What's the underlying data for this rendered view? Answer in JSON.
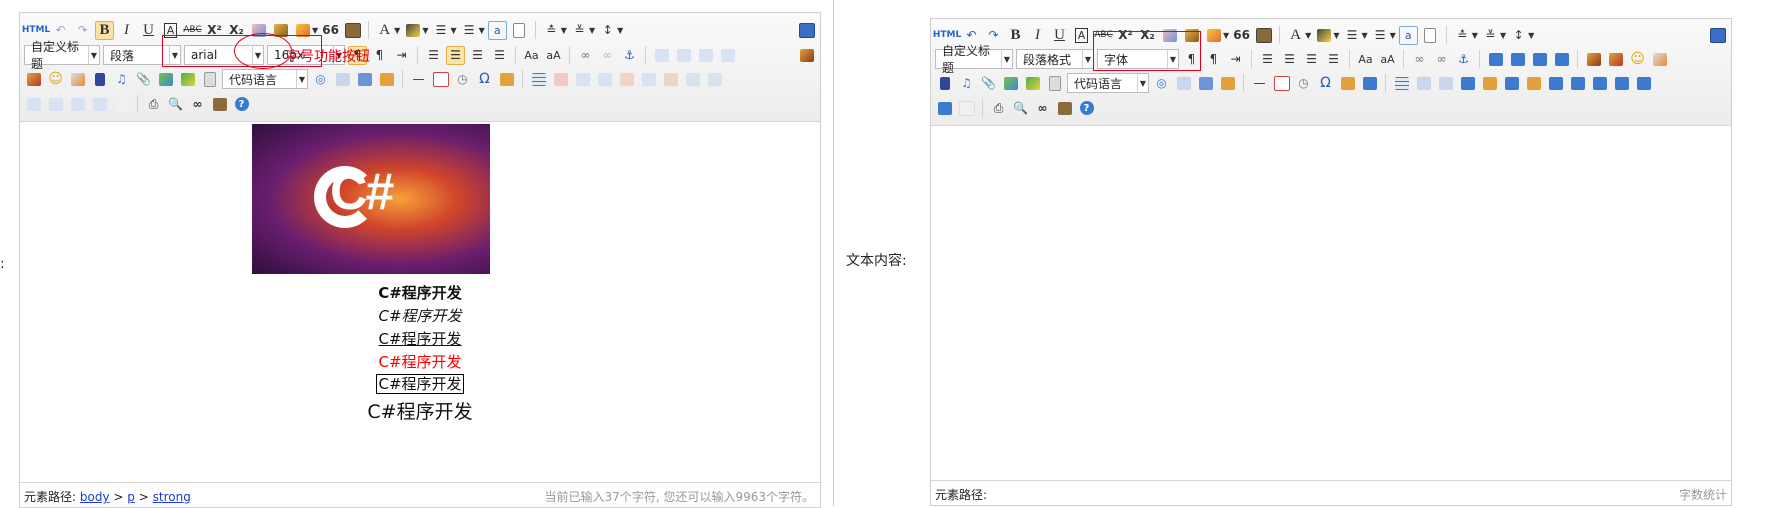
{
  "left_side_label": ":",
  "editor_left": {
    "toolbar_row1": {
      "source_label": "HTML",
      "bold_label": "B",
      "italic_label": "I",
      "underline_label": "U",
      "fontborder_label": "A",
      "strike_label": "ABC",
      "superscript_label": "X²",
      "subscript_label": "X₂",
      "blockquote_label": "66",
      "forecolor_label": "A",
      "insertframe_label": "a"
    },
    "toolbar_row2": {
      "customstyle_value": "自定义标题",
      "paragraph_value": "段落",
      "fontfamily_value": "arial",
      "fontsize_value": "16px"
    },
    "toolbar_row3": {
      "code_language_value": "代码语言",
      "omega_label": "Ω"
    },
    "content": {
      "image_logo_text": "C#",
      "lines": [
        "C#程序开发",
        "C#程序开发",
        "C#程序开发",
        "C#程序开发",
        "C#程序开发",
        "C#程序开发"
      ],
      "red_color": "#ff0000"
    },
    "status": {
      "path_label": "元素路径:",
      "path_items": [
        "body",
        "p",
        "strong"
      ],
      "path_sep": ">",
      "word_count": "当前已输入37个字符, 您还可以输入9963个字符。"
    },
    "annotation_text": "字号功能按钮",
    "annotation_color": "#e0001b"
  },
  "right_side_label": "文本内容:",
  "editor_right": {
    "toolbar_row1": {
      "source_label": "HTML",
      "bold_label": "B",
      "italic_label": "I",
      "underline_label": "U",
      "fontborder_label": "A",
      "strike_label": "ABC",
      "superscript_label": "X²",
      "subscript_label": "X₂",
      "blockquote_label": "66",
      "forecolor_label": "A",
      "insertframe_label": "a"
    },
    "toolbar_row2": {
      "customstyle_value": "自定义标题",
      "paragraph_value": "段落格式",
      "fontfamily_value": "字体"
    },
    "toolbar_row3": {
      "code_language_value": "代码语言",
      "omega_label": "Ω"
    },
    "status": {
      "path_label": "元素路径:",
      "word_count": "字数统计"
    }
  }
}
